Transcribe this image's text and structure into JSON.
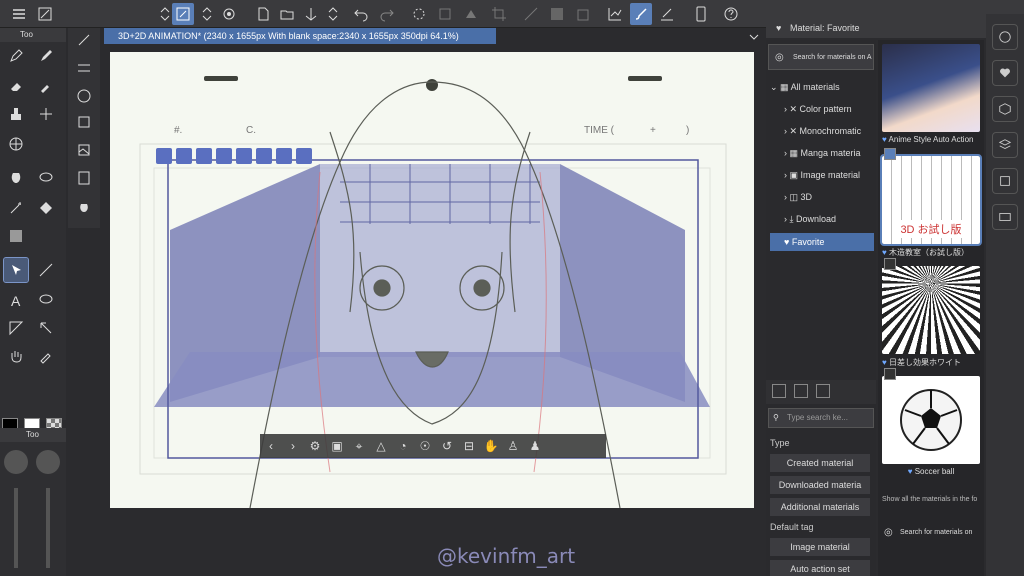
{
  "document": {
    "tab_title": "3D+2D ANIMATION* (2340 x 1655px With blank space:2340 x 1655px 350dpi 64.1%)"
  },
  "paper_labels": {
    "number": "#.",
    "cut": "C.",
    "time": "TIME (",
    "plus": "+",
    "close": ")"
  },
  "toolbar_icons": [
    "menu-icon",
    "new-layer-icon",
    "chevron-updown-icon",
    "brush-select-icon",
    "chevron-updown-icon",
    "settings-icon",
    "new-file-icon",
    "open-folder-icon",
    "save-icon",
    "chevron-updown-icon",
    "undo-icon",
    "redo-icon",
    "loading-icon",
    "transform-icon",
    "fill-icon",
    "crop-icon",
    "ruler-icon",
    "mask-icon",
    "fill-bucket-icon",
    "chart-icon",
    "brush-icon",
    "edit-line-icon",
    "phone-icon",
    "help-icon"
  ],
  "tool_palette": {
    "tab": "Too"
  },
  "color_panel": {
    "tab": "Too"
  },
  "material_panel": {
    "title": "Material: Favorite",
    "search_placeholder": "Search for materials on A",
    "tree": [
      {
        "label": "All materials",
        "icon": "grid-icon"
      },
      {
        "label": "Color pattern",
        "icon": "x-icon"
      },
      {
        "label": "Monochromatic",
        "icon": "x-icon"
      },
      {
        "label": "Manga materia",
        "icon": "grid-icon"
      },
      {
        "label": "Image material",
        "icon": "image-icon"
      },
      {
        "label": "3D",
        "icon": "cube-icon"
      },
      {
        "label": "Download",
        "icon": "download-icon"
      },
      {
        "label": "Favorite",
        "icon": "heart-icon"
      }
    ],
    "tag_search_placeholder": "Type search ke...",
    "type_heading": "Type",
    "type_buttons": [
      "Created material",
      "Downloaded materia",
      "Additional materials"
    ],
    "default_tag_heading": "Default tag",
    "tag_buttons": [
      "Image material",
      "Auto action set"
    ]
  },
  "materials": [
    {
      "caption": "Anime Style Auto Action",
      "thumb_text": ""
    },
    {
      "caption": "木造教室（お試し版）",
      "thumb_text": "3D お試し版"
    },
    {
      "caption": "日差し効果ホワイト",
      "thumb_text": ""
    },
    {
      "caption": "Soccer ball",
      "thumb_text": ""
    }
  ],
  "materials_note": "Show all the materials in the fo",
  "materials_search": "Search for materials on",
  "watermark": "@kevinfm_art",
  "colors": {
    "accent": "#4a6fa8",
    "panel_bg": "#2b2b2e"
  }
}
